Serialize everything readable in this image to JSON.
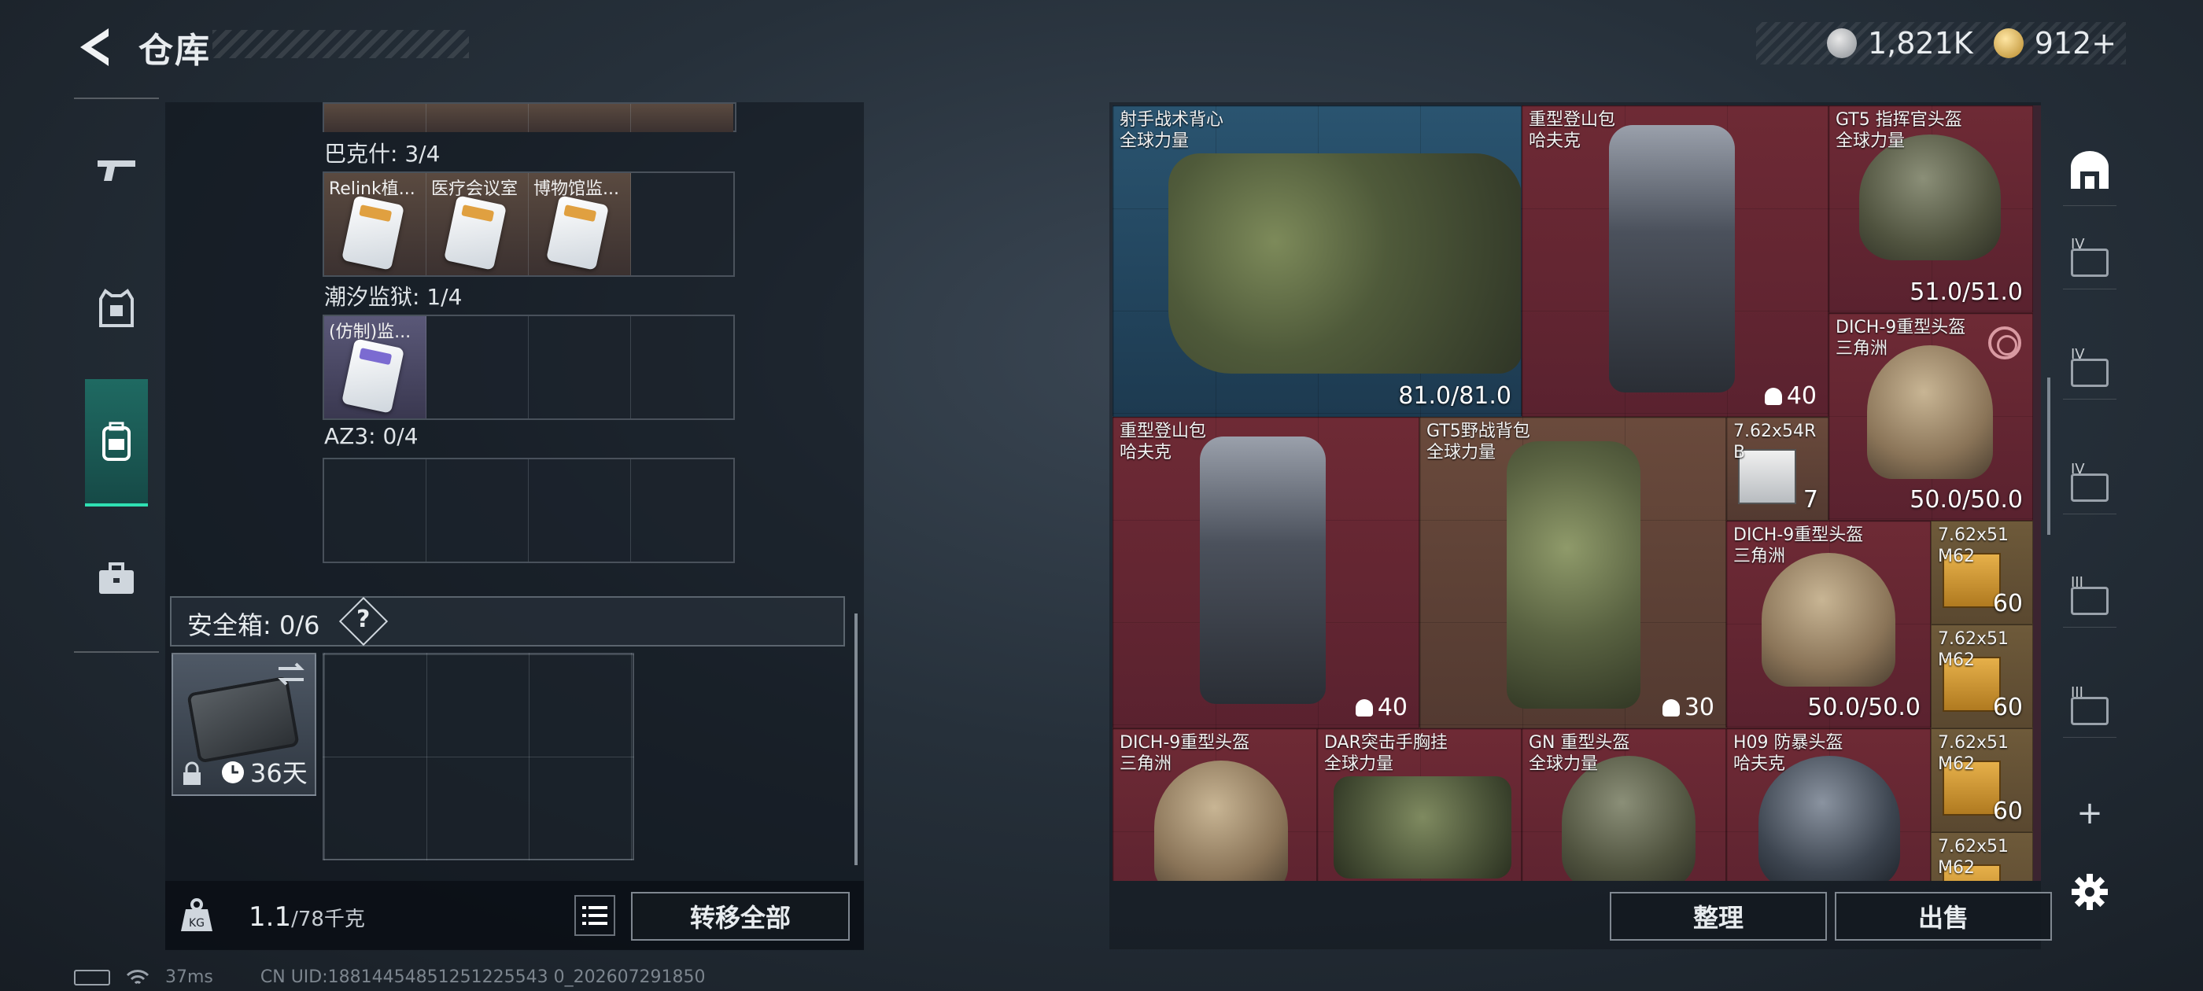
{
  "header": {
    "title": "仓库",
    "silver": "1,821K",
    "gold": "912+"
  },
  "left_panel": {
    "sections": [
      {
        "label": "巴克什: 3/4",
        "cells": [
          "Relink植...",
          "医疗会议室",
          "博物馆监...",
          ""
        ]
      },
      {
        "label": "潮汐监狱: 1/4",
        "cells": [
          "(仿制)监...",
          "",
          "",
          ""
        ]
      },
      {
        "label": "AZ3: 0/4",
        "cells": [
          "",
          "",
          "",
          ""
        ]
      }
    ],
    "safebox": {
      "label": "安全箱: 0/6",
      "help": "?",
      "duration": "36天"
    },
    "capacity": {
      "value": "1.1",
      "max": "/78千克"
    },
    "transfer_all": "转移全部"
  },
  "inventory": [
    {
      "name": "射手战术背心\n全球力量",
      "value": "81.0/81.0",
      "color": "blue"
    },
    {
      "name": "重型登山包\n哈夫克",
      "capacity": "40",
      "color": "red"
    },
    {
      "name": "GT5 指挥官头盔\n全球力量",
      "value": "51.0/51.0",
      "color": "red"
    },
    {
      "name": "DICH-9重型头盔\n三角洲",
      "value": "50.0/50.0",
      "color": "red"
    },
    {
      "name": "重型登山包\n哈夫克",
      "capacity": "40",
      "color": "red"
    },
    {
      "name": "GT5野战背包\n全球力量",
      "capacity": "30",
      "color": "brown"
    },
    {
      "name": "7.62x54R\nB",
      "value": "7",
      "color": "brown"
    },
    {
      "name": "DICH-9重型头盔\n三角洲",
      "value": "50.0/50.0",
      "color": "red"
    },
    {
      "name": "7.62x51\nM62",
      "value": "60",
      "color": "ammo"
    },
    {
      "name": "7.62x51\nM62",
      "value": "60",
      "color": "ammo"
    },
    {
      "name": "DICH-9重型头盔\n三角洲",
      "color": "red"
    },
    {
      "name": "DAR突击手胸挂\n全球力量",
      "color": "red"
    },
    {
      "name": "GN 重型头盔\n全球力量",
      "color": "red"
    },
    {
      "name": "H09 防暴头盔\n哈夫克",
      "color": "red"
    },
    {
      "name": "7.62x51\nM62",
      "value": "60",
      "color": "ammo"
    },
    {
      "name": "7.62x51\nM62",
      "color": "ammo"
    }
  ],
  "actions": {
    "sort": "整理",
    "sell": "出售"
  },
  "right_nav": {
    "tiers": [
      "IV",
      "IV",
      "IV",
      "III",
      "III"
    ],
    "add": "+"
  },
  "status": {
    "ping": "37ms",
    "uid": "CN UID:18814454851251225543 0_202607291850"
  }
}
